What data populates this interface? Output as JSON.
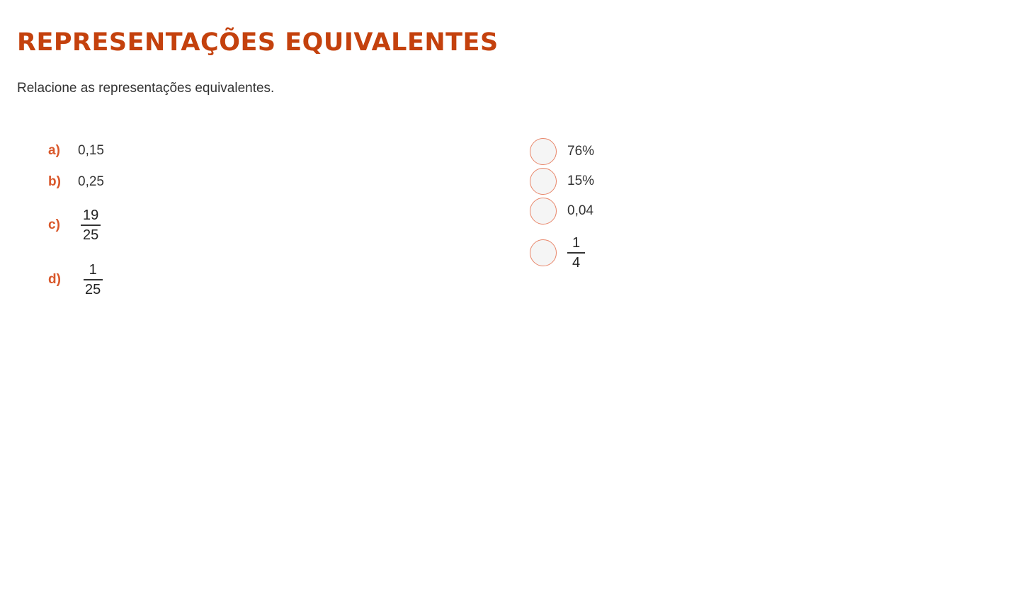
{
  "title": "REPRESENTAÇÕES EQUIVALENTES",
  "instruction": "Relacione as representações equivalentes.",
  "left_items": [
    {
      "letter": "a)",
      "value": "0,15"
    },
    {
      "letter": "b)",
      "value": "0,25"
    },
    {
      "letter": "c)",
      "numerator": "19",
      "denominator": "25"
    },
    {
      "letter": "d)",
      "numerator": "1",
      "denominator": "25"
    }
  ],
  "right_items": [
    {
      "value": "76%"
    },
    {
      "value": "15%"
    },
    {
      "value": "0,04"
    },
    {
      "numerator": "1",
      "denominator": "4"
    }
  ],
  "colors": {
    "title": "#c4410d",
    "letter": "#d9572a",
    "circle_border": "#e8866a",
    "circle_fill": "#f5f5f5"
  }
}
